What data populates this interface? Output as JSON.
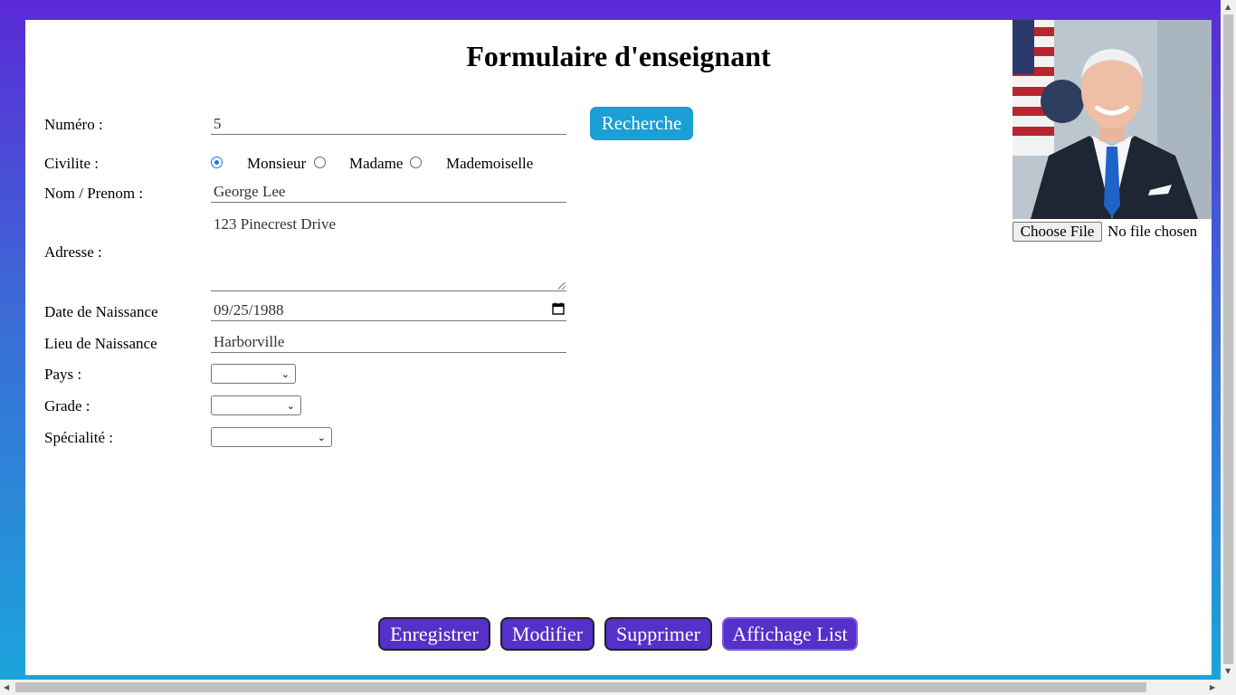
{
  "form": {
    "title": "Formulaire d'enseignant",
    "labels": {
      "numero": "Numéro :",
      "civilite": "Civilite :",
      "nom": "Nom / Prenom :",
      "adresse": "Adresse :",
      "date": "Date de Naissance",
      "lieu": "Lieu de Naissance",
      "pays": "Pays :",
      "grade": "Grade :",
      "specialite": "Spécialité :"
    },
    "values": {
      "numero": "5",
      "nom": "George Lee",
      "adresse": "123 Pinecrest Drive",
      "date": "09/25/1988",
      "lieu": "Harborville",
      "pays": "",
      "grade": "",
      "specialite": ""
    },
    "civilite_options": [
      "Monsieur",
      "Madame",
      "Mademoiselle"
    ],
    "civilite_selected": "Monsieur",
    "search_button": "Recherche"
  },
  "photo": {
    "file_button": "Choose File",
    "file_status": "No file chosen"
  },
  "actions": {
    "save": "Enregistrer",
    "modify": "Modifier",
    "delete": "Supprimer",
    "list": "Affichage List"
  },
  "colors": {
    "accent_purple": "#5530c9",
    "search_blue": "#1a9fd6"
  }
}
